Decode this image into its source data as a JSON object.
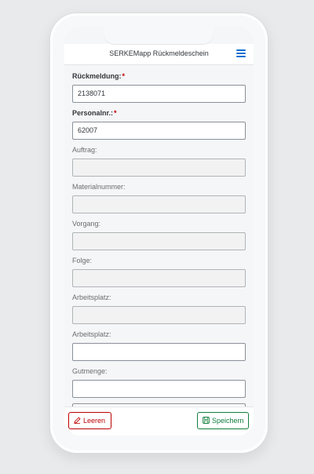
{
  "app": {
    "title": "SERKEMapp Rückmeldeschein"
  },
  "fields": [
    {
      "label": "Rückmeldung:",
      "required": true,
      "value": "2138071",
      "readonly": false
    },
    {
      "label": "Personalnr.:",
      "required": true,
      "value": "62007",
      "readonly": false
    },
    {
      "label": "Auftrag:",
      "required": false,
      "value": "",
      "readonly": true
    },
    {
      "label": "Materialnummer:",
      "required": false,
      "value": "",
      "readonly": true
    },
    {
      "label": "Vorgang:",
      "required": false,
      "value": "",
      "readonly": true
    },
    {
      "label": "Folge:",
      "required": false,
      "value": "",
      "readonly": true
    },
    {
      "label": "Arbeitsplatz:",
      "required": false,
      "value": "",
      "readonly": true
    },
    {
      "label": "Arbeitsplatz:",
      "required": false,
      "value": "",
      "readonly": false
    },
    {
      "label": "Gutmenge:",
      "required": false,
      "value": "",
      "readonly": false
    }
  ],
  "required_marker": "*",
  "footer": {
    "clear_label": "Leeren",
    "save_label": "Speichern"
  },
  "colors": {
    "accent": "#0a6ed1",
    "reject": "#bb0000",
    "accept": "#107e3e"
  },
  "icons": {
    "menu": "hamburger-icon",
    "clear": "pencil-icon",
    "save": "floppy-disk-icon"
  }
}
